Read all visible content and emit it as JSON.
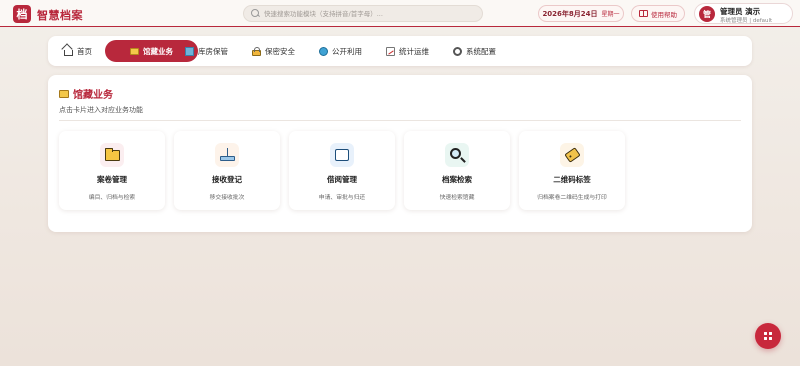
{
  "header": {
    "logo_char": "档",
    "app_title": "智慧档案",
    "search_placeholder": "快速搜索功能模块（支持拼音/首字母）...",
    "date": "2026年8月24日",
    "weekday": "星期一",
    "help_label": "使用帮助",
    "user": {
      "avatar_char": "管",
      "name": "管理员 演示",
      "role": "系统管理员 | default"
    }
  },
  "nav": {
    "tabs": [
      {
        "label": "首页",
        "icon": "home-icon",
        "active": false
      },
      {
        "label": "馆藏业务",
        "icon": "folder-icon",
        "active": true
      },
      {
        "label": "库房保管",
        "icon": "building-icon",
        "active": false
      },
      {
        "label": "保密安全",
        "icon": "lock-icon",
        "active": false
      },
      {
        "label": "公开利用",
        "icon": "globe-icon",
        "active": false
      },
      {
        "label": "统计运维",
        "icon": "chart-icon",
        "active": false
      },
      {
        "label": "系统配置",
        "icon": "gear-icon",
        "active": false
      }
    ]
  },
  "section": {
    "title": "馆藏业务",
    "description": "点击卡片进入对应业务功能",
    "cards": [
      {
        "title": "案卷管理",
        "desc": "编目、归档与检索",
        "icon": "folder-icon",
        "bg": "#fbeef0"
      },
      {
        "title": "接收登记",
        "desc": "移交接收批次",
        "icon": "inbox-icon",
        "bg": "#fdf3ea"
      },
      {
        "title": "借阅管理",
        "desc": "申请、审批与归还",
        "icon": "tablet-icon",
        "bg": "#e8f1fb"
      },
      {
        "title": "档案检索",
        "desc": "快速检索馆藏",
        "icon": "magnifier-icon",
        "bg": "#e9f6f2"
      },
      {
        "title": "二维码标签",
        "desc": "归档案卷二维码生成与打印",
        "icon": "tag-icon",
        "bg": "#fdf4e6"
      }
    ]
  },
  "colors": {
    "accent": "#b8283c",
    "background": "#efe7e0"
  }
}
